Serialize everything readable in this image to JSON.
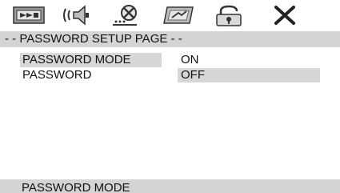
{
  "tabs": [
    {
      "name": "general-setup",
      "icon": "general-setup-icon"
    },
    {
      "name": "audio-setup",
      "icon": "speaker-icon"
    },
    {
      "name": "dolby-setup",
      "icon": "dolby-icon"
    },
    {
      "name": "preference-setup",
      "icon": "preference-icon"
    },
    {
      "name": "password-setup",
      "icon": "lock-icon",
      "active": true
    },
    {
      "name": "exit-setup",
      "icon": "close-icon"
    }
  ],
  "page": {
    "title": "- - PASSWORD SETUP PAGE - -"
  },
  "menu": {
    "items": [
      {
        "label": "PASSWORD MODE",
        "value": "ON",
        "selected": true
      },
      {
        "label": "PASSWORD",
        "value": "OFF",
        "option_highlighted": true
      }
    ]
  },
  "status": {
    "text": "PASSWORD MODE"
  },
  "colors": {
    "highlight": "#d7d7d7",
    "bar": "#d4d4d4",
    "background": "#ffffff"
  }
}
